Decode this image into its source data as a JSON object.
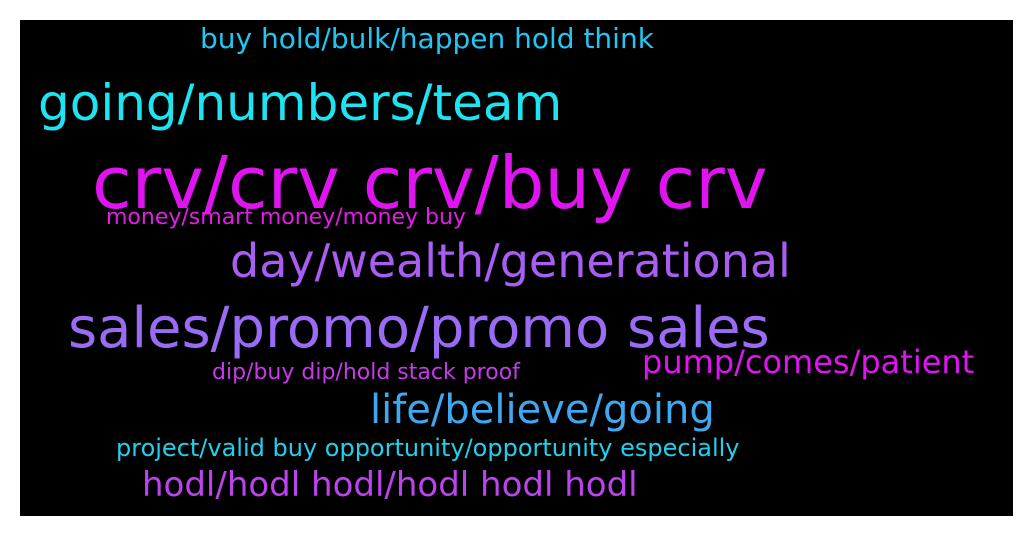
{
  "cloud": {
    "background": "#000000",
    "words": [
      {
        "text": "buy hold/bulk/happen hold think",
        "color": "#22c6f2"
      },
      {
        "text": "going/numbers/team",
        "color": "#1ee3f0"
      },
      {
        "text": "crv/crv crv/buy crv",
        "color": "#e014f0"
      },
      {
        "text": "money/smart money/money buy",
        "color": "#e21ee6"
      },
      {
        "text": "day/wealth/generational",
        "color": "#a85ef2"
      },
      {
        "text": "sales/promo/promo sales",
        "color": "#9a6cf6"
      },
      {
        "text": "dip/buy dip/hold stack proof",
        "color": "#c63ae8"
      },
      {
        "text": "pump/comes/patient",
        "color": "#e014f0"
      },
      {
        "text": "life/believe/going",
        "color": "#3fa8f0"
      },
      {
        "text": "project/valid buy opportunity/opportunity especially",
        "color": "#22d0ee"
      },
      {
        "text": "hodl/hodl hodl/hodl hodl hodl",
        "color": "#bb44ec"
      }
    ]
  }
}
